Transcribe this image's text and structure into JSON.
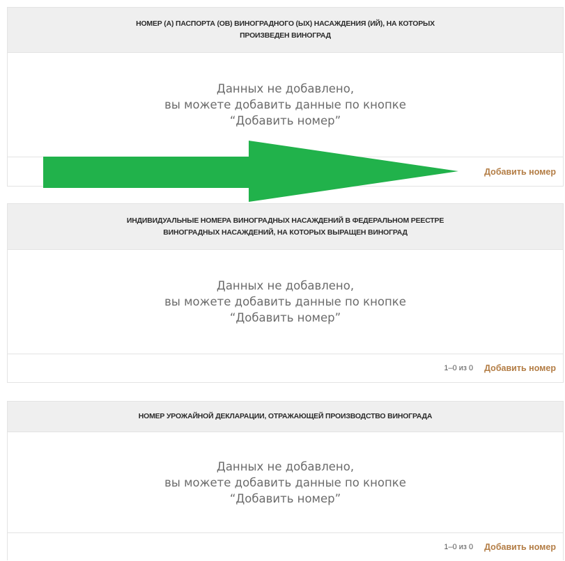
{
  "sections": [
    {
      "title_line1": "НОМЕР (А) ПАСПОРТА (ОВ) ВИНОГРАДНОГО (ЫХ) НАСАЖДЕНИЯ (ИЙ), НА КОТОРЫХ",
      "title_line2": "ПРОИЗВЕДЕН ВИНОГРАД",
      "empty_line1": "Данных не добавлено,",
      "empty_line2": "вы можете добавить данные по кнопке",
      "empty_line3": "“Добавить номер”",
      "pagination": "",
      "add_label": "Добавить номер"
    },
    {
      "title_line1": "ИНДИВИДУАЛЬНЫЕ НОМЕРА ВИНОГРАДНЫХ НАСАЖДЕНИЙ В ФЕДЕРАЛЬНОМ РЕЕСТРЕ",
      "title_line2": "ВИНОГРАДНЫХ НАСАЖДЕНИЙ, НА КОТОРЫХ ВЫРАЩЕН ВИНОГРАД",
      "empty_line1": "Данных не добавлено,",
      "empty_line2": "вы можете добавить данные по кнопке",
      "empty_line3": "“Добавить номер”",
      "pagination": "1–0 из 0",
      "add_label": "Добавить номер"
    },
    {
      "title_line1": "НОМЕР УРОЖАЙНОЙ ДЕКЛАРАЦИИ, ОТРАЖАЮЩЕЙ ПРОИЗВОДСТВО ВИНОГРАДА",
      "empty_line1": "Данных не добавлено,",
      "empty_line2": "вы можете добавить данные по кнопке",
      "empty_line3": "“Добавить номер”",
      "pagination": "1–0 из 0",
      "add_label": "Добавить номер"
    }
  ],
  "colors": {
    "header_bg": "#efefef",
    "link": "#b37d45",
    "arrow": "#21b24b",
    "empty_text": "#6b6b6b"
  }
}
